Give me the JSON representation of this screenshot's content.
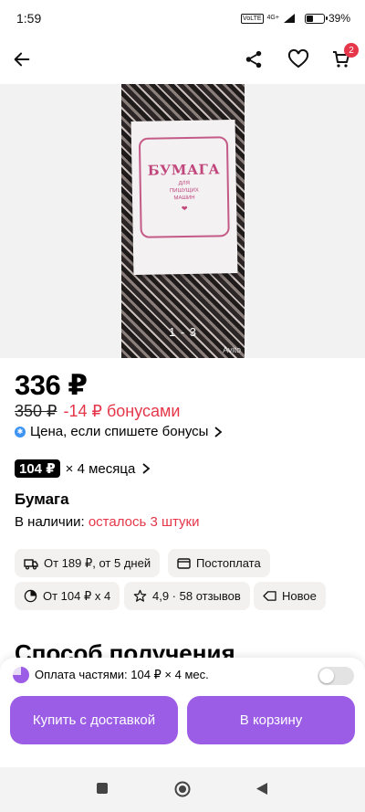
{
  "status_bar": {
    "time": "1:59",
    "sim": "VoLTE",
    "network": "4G+",
    "battery": "39%",
    "battery_level": 0.39
  },
  "app_bar": {
    "back_icon": "arrow-left-icon",
    "share_icon": "share-icon",
    "favorite_icon": "heart-icon",
    "cart_icon": "cart-icon",
    "cart_count": "2"
  },
  "gallery": {
    "photo_counter": "1 - 3",
    "watermark": "Avito",
    "sheet_title": "БУМАГА",
    "sheet_subtitle_1": "ДЛЯ",
    "sheet_subtitle_2": "ПИШУЩИХ",
    "sheet_subtitle_3": "МАШИН"
  },
  "price": {
    "current": "336 ₽",
    "old": "350 ₽",
    "bonus_discount": "-14 ₽ бонусами",
    "bonus_note": "Цена, если спишете бонусы"
  },
  "installment": {
    "amount": "104 ₽",
    "term": "× 4 месяца"
  },
  "product": {
    "title": "Бумага",
    "stock_label": "В наличии:",
    "stock_value": "осталось 3 штуки"
  },
  "chips": {
    "delivery": "От 189 ₽, от 5 дней",
    "postpay": "Постоплата",
    "parts": "От 104 ₽ x 4",
    "rating": "4,9 · 58 отзывов",
    "condition": "Новое"
  },
  "section_heading": "Способ получения",
  "bottom_panel": {
    "parts_text": "Оплата частями: 104 ₽ × 4 мес.",
    "buy_delivery": "Купить с доставкой",
    "to_cart": "В корзину"
  },
  "accent_colors": {
    "primary": "#9b5de5",
    "alert": "#e5364a",
    "bonus": "#3d94f5"
  }
}
